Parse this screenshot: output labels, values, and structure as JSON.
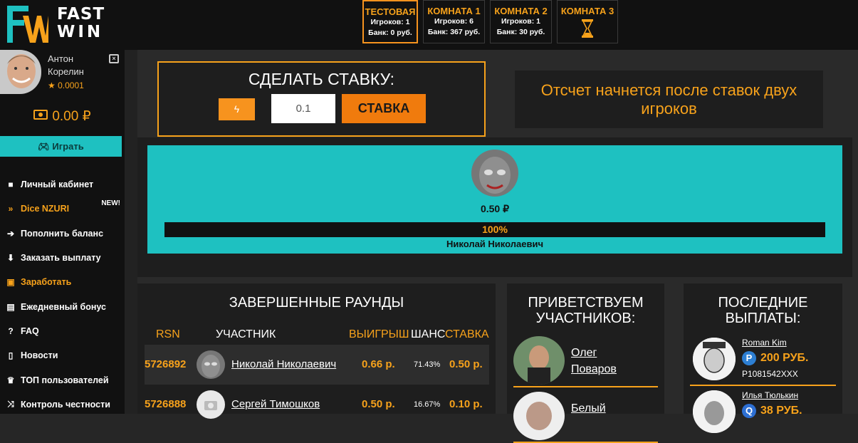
{
  "brand": {
    "line1": "FAST",
    "line2": "WIN",
    "colors": {
      "teal": "#1ec1c1",
      "orange": "#f7a21b"
    }
  },
  "rooms": [
    {
      "name": "ТЕСТОВАЯ",
      "players": "Игроков: 1",
      "bank": "Банк: 0 руб.",
      "active": true
    },
    {
      "name": "КОМНАТА 1",
      "players": "Игроков: 6",
      "bank": "Банк: 367 руб.",
      "active": false
    },
    {
      "name": "КОМНАТА 2",
      "players": "Игроков: 1",
      "bank": "Банк: 30 руб.",
      "active": false
    },
    {
      "name": "КОМНАТА 3",
      "icon": "hourglass-icon",
      "active": false
    }
  ],
  "user": {
    "first_name": "Антон",
    "last_name": "Корелин",
    "rating": "★ 0.0001",
    "balance": "0.00 ₽"
  },
  "sidebar": {
    "play_label": "Играть",
    "items": [
      {
        "label": "Личный кабинет",
        "icon": "briefcase-icon"
      },
      {
        "label": "Dice NZURI",
        "icon": "chevrons-right-icon",
        "badge": "NEW!"
      },
      {
        "label": "Пополнить баланс",
        "icon": "arrow-circle-right-icon"
      },
      {
        "label": "Заказать выплату",
        "icon": "arrow-circle-down-icon"
      },
      {
        "label": "Заработать",
        "icon": "money-icon"
      },
      {
        "label": "Ежедневный бонус",
        "icon": "gift-icon"
      },
      {
        "label": "FAQ",
        "icon": "question-circle-icon"
      },
      {
        "label": "Новости",
        "icon": "bookmark-icon"
      },
      {
        "label": "ТОП пользователей",
        "icon": "trophy-icon"
      },
      {
        "label": "Контроль честности",
        "icon": "shuffle-icon"
      }
    ]
  },
  "bet": {
    "title": "СДЕЛАТЬ СТАВКУ:",
    "input_value": "0.1",
    "button_label": "СТАВКА"
  },
  "countdown": {
    "text": "Отсчет начнется после ставок двух игроков"
  },
  "arena": {
    "amount": "0.50 ₽",
    "chance_text": "100%",
    "chance_value": 100,
    "player": "Николай Николаевич"
  },
  "rounds": {
    "title": "ЗАВЕРШЕННЫЕ РАУНДЫ",
    "headers": {
      "rsn": "RSN",
      "player": "УЧАСТНИК",
      "win": "ВЫИГРЫШ",
      "chance": "ШАНС",
      "bet": "СТАВКА"
    },
    "rows": [
      {
        "rsn": "5726892",
        "player": "Николай Николаевич",
        "win": "0.66 р.",
        "chance": "71.43%",
        "bet": "0.50 р."
      },
      {
        "rsn": "5726888",
        "player": "Сергей Тимошков",
        "win": "0.50 р.",
        "chance": "16.67%",
        "bet": "0.10 р."
      }
    ]
  },
  "welcome": {
    "title_line1": "ПРИВЕТСТВУЕМ",
    "title_line2": "УЧАСТНИКОВ:",
    "users": [
      {
        "first": "Олег",
        "last": "Поваров"
      },
      {
        "first": "Белый",
        "last": ""
      }
    ]
  },
  "payouts": {
    "title_line1": "ПОСЛЕДНИЕ",
    "title_line2": "ВЫПЛАТЫ:",
    "items": [
      {
        "name": "Roman Kim",
        "amount": "200 РУБ.",
        "account": "P1081542XXX",
        "method_icon": "payeer-icon"
      },
      {
        "name": "Илья Тюлькин",
        "amount": "38 РУБ.",
        "account": "",
        "method_icon": "qiwi-icon"
      }
    ]
  }
}
